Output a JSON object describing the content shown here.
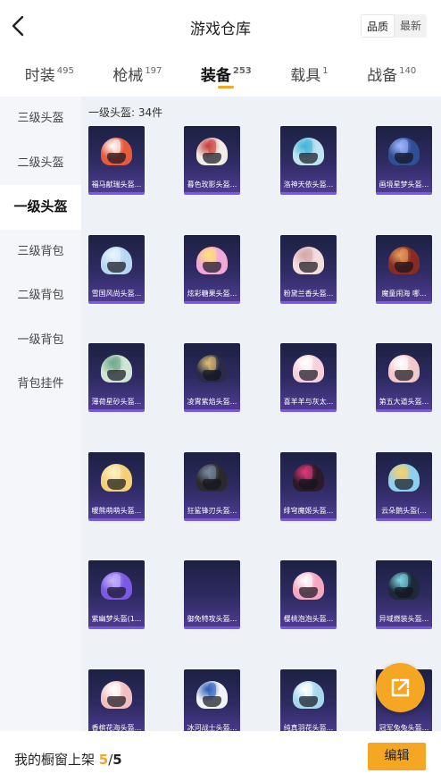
{
  "header": {
    "title": "游戏仓库",
    "sort_options": [
      "品质",
      "最新"
    ],
    "sort_selected": "品质"
  },
  "tabs": [
    {
      "label": "时装",
      "count": "495",
      "active": false
    },
    {
      "label": "枪械",
      "count": "197",
      "active": false
    },
    {
      "label": "装备",
      "count": "253",
      "active": true
    },
    {
      "label": "载具",
      "count": "1",
      "active": false
    },
    {
      "label": "战备",
      "count": "140",
      "active": false
    }
  ],
  "sidebar": {
    "items": [
      {
        "label": "三级头盔",
        "active": false
      },
      {
        "label": "二级头盔",
        "active": false
      },
      {
        "label": "一级头盔",
        "active": true
      },
      {
        "label": "三级背包",
        "active": false
      },
      {
        "label": "二级背包",
        "active": false
      },
      {
        "label": "一级背包",
        "active": false
      },
      {
        "label": "背包挂件",
        "active": false
      }
    ]
  },
  "content": {
    "section_title": "一级头盔: 34件",
    "items": [
      {
        "name": "福马献瑞头盔...",
        "color": "#e85a3c",
        "accent": "#ffffff"
      },
      {
        "name": "暮色玫影头盔...",
        "color": "#f2ece6",
        "accent": "#c83a3a"
      },
      {
        "name": "洛神天依头盔...",
        "color": "#bfe3f0",
        "accent": "#3fb5d8"
      },
      {
        "name": "画境星梦头盔...",
        "color": "#2e4e96",
        "accent": "#9fb8ff"
      },
      {
        "name": "雪国风尚头盔...",
        "color": "#b8d8f0",
        "accent": "#e8f4ff"
      },
      {
        "name": "炫彩糖果头盔...",
        "color": "#f2a8d8",
        "accent": "#ffe07a"
      },
      {
        "name": "粉黛兰香头盔...",
        "color": "#f3dede",
        "accent": "#d4a8a8"
      },
      {
        "name": "魔童闹海 哪...",
        "color": "#8a2a22",
        "accent": "#e8a060"
      },
      {
        "name": "薄荷星砂头盔...",
        "color": "#cfe6d6",
        "accent": "#6fa88a"
      },
      {
        "name": "凌霄紫焰头盔...",
        "color": "#2a2a4a",
        "accent": "#e0c070"
      },
      {
        "name": "喜羊羊与灰太...",
        "color": "#f6d0dc",
        "accent": "#ffffff"
      },
      {
        "name": "第五大道头盔...",
        "color": "#f3c8c8",
        "accent": "#ffffff"
      },
      {
        "name": "暖熊萌萌头盔...",
        "color": "#f3cf76",
        "accent": "#fff1c2"
      },
      {
        "name": "狂鲨锋刃头盔...",
        "color": "#2a2a2e",
        "accent": "#7a8aa0"
      },
      {
        "name": "绯穹魔姬头盔...",
        "color": "#2a1a2a",
        "accent": "#e23a7a"
      },
      {
        "name": "云朵鹅头盔(...",
        "color": "#8fd0ee",
        "accent": "#f5d26a"
      },
      {
        "name": "紫幽梦头盔(1...",
        "color": "#7a5ae0",
        "accent": "#c8b6ff"
      },
      {
        "name": "御免特攻头盔...",
        "color": "",
        "accent": ""
      },
      {
        "name": "樱桃泡泡头盔...",
        "color": "#f2a8c0",
        "accent": "#ffffff"
      },
      {
        "name": "异域燃装头盔...",
        "color": "#1e2a3a",
        "accent": "#7fd8e8"
      },
      {
        "name": "香槟花海头盔...",
        "color": "#f3c0c0",
        "accent": "#ffffff"
      },
      {
        "name": "冰河战士头盔...",
        "color": "#f2f4f8",
        "accent": "#2a5ab8"
      },
      {
        "name": "纯真羽花头盔...",
        "color": "#a8d8ee",
        "accent": "#ffffff"
      },
      {
        "name": "冠军兔兔头盔...",
        "color": "#f2f2f2",
        "accent": "#f5a623"
      }
    ]
  },
  "fab": {
    "icon": "share-external-icon"
  },
  "bottom_bar": {
    "label": "我的橱窗上架",
    "current": "5",
    "separator": "/",
    "total": "5",
    "edit_label": "编辑"
  },
  "colors": {
    "accent": "#f5a623",
    "card_border": "#7a5ae0",
    "card_bg": "#2f2b63"
  }
}
